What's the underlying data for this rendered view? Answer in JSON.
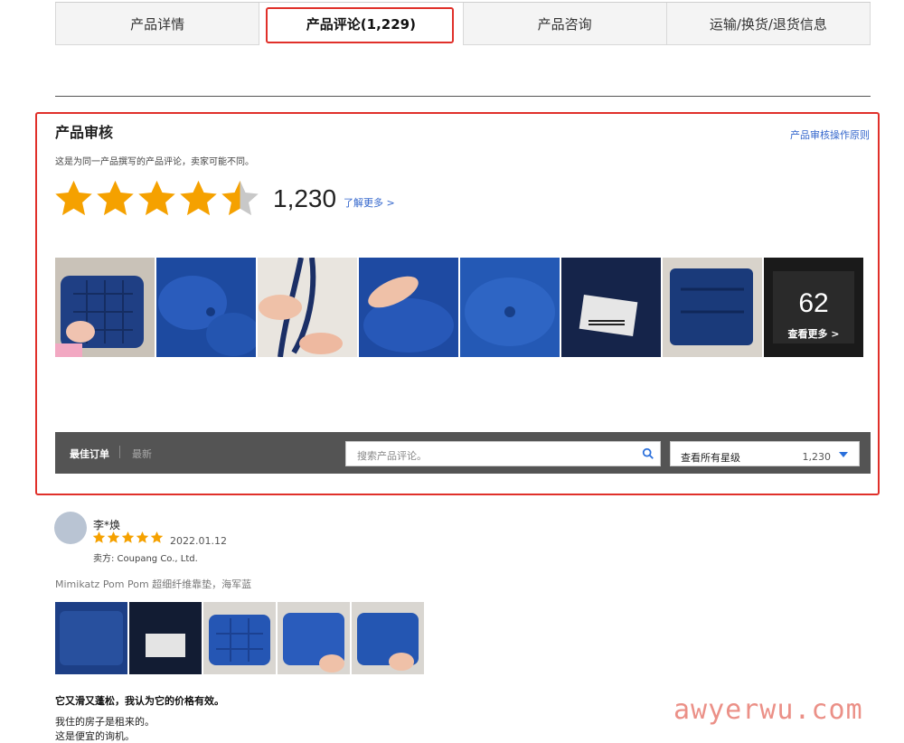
{
  "tabs": [
    {
      "label": "产品详情"
    },
    {
      "label": "产品评论(1,229)"
    },
    {
      "label": "产品咨询"
    },
    {
      "label": "运输/换货/退货信息"
    }
  ],
  "summary": {
    "title": "产品审核",
    "policy_link": "产品审核操作原则",
    "description": "这是为同一产品撰写的产品评论，卖家可能不同。",
    "rating": 4.5,
    "rating_count": "1,230",
    "learn_more": "了解更多 >",
    "more_photos": {
      "count": "62",
      "label": "查看更多 >"
    }
  },
  "filter": {
    "sort_best": "最佳订单",
    "sort_new": "最新",
    "search_placeholder": "搜索产品评论。",
    "star_filter_label": "查看所有星级",
    "star_filter_count": "1,230"
  },
  "review": {
    "name": "李*焕",
    "stars": 5,
    "date": "2022.01.12",
    "seller": "卖方: Coupang Co., Ltd.",
    "product": "Mimikatz Pom Pom 超细纤维靠垫，海军蓝",
    "headline": "它又滑又蓬松，我认为它的价格有效。",
    "line1": "我住的房子是租来的。",
    "line2": "这是便宜的询机。"
  },
  "watermark": "awyerwu.com",
  "colors": {
    "star": "#f5a100",
    "star_empty": "#c8c8c8",
    "highlight": "#e0302a",
    "link": "#3366cc",
    "bar": "#545454"
  }
}
